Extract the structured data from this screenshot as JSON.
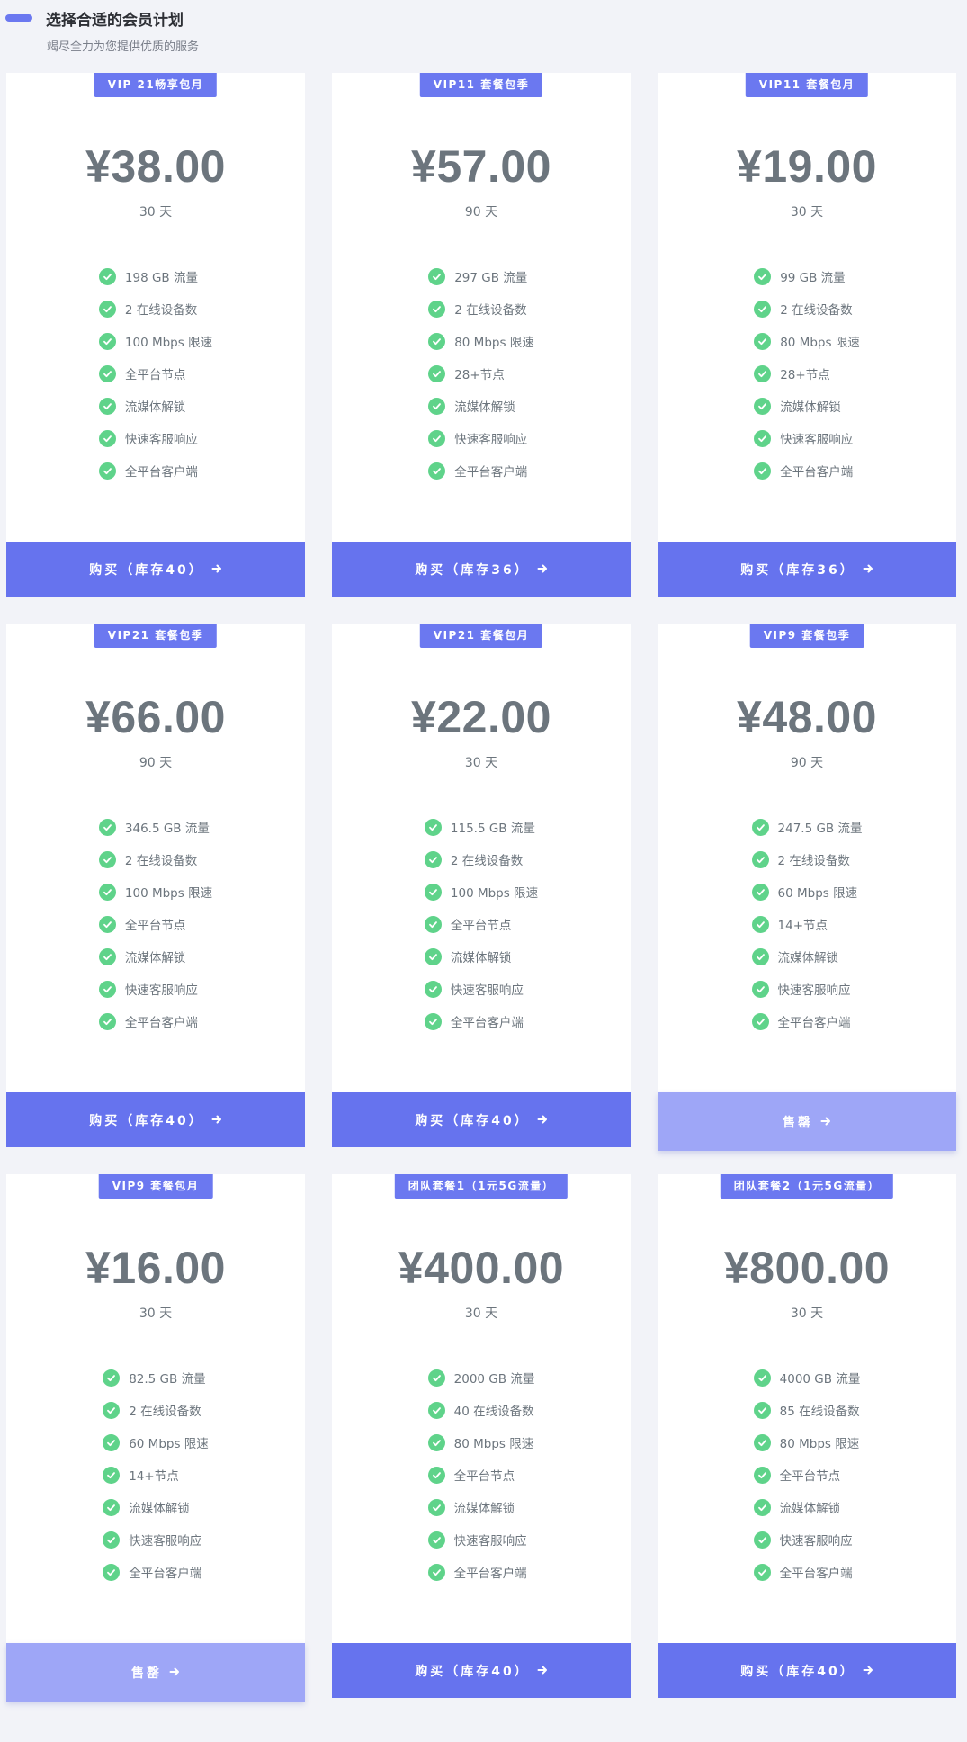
{
  "header": {
    "title": "选择合适的会员计划",
    "subtitle": "竭尽全力为您提供优质的服务"
  },
  "colors": {
    "accent": "#6b78f0",
    "button": "#6673ee",
    "button_soldout": "#9ea6f7",
    "check": "#5fd38a",
    "background": "#f2f3f8"
  },
  "plans": [
    {
      "badge": "VIP 21畅享包月",
      "price": "¥38.00",
      "duration": "30 天",
      "features": [
        "198 GB 流量",
        "2 在线设备数",
        "100 Mbps 限速",
        "全平台节点",
        "流媒体解锁",
        "快速客服响应",
        "全平台客户端"
      ],
      "button": "购买（库存40）",
      "soldout": false
    },
    {
      "badge": "VIP11 套餐包季",
      "price": "¥57.00",
      "duration": "90 天",
      "features": [
        "297 GB 流量",
        "2 在线设备数",
        "80 Mbps 限速",
        "28+节点",
        "流媒体解锁",
        "快速客服响应",
        "全平台客户端"
      ],
      "button": "购买（库存36）",
      "soldout": false
    },
    {
      "badge": "VIP11 套餐包月",
      "price": "¥19.00",
      "duration": "30 天",
      "features": [
        "99 GB 流量",
        "2 在线设备数",
        "80 Mbps 限速",
        "28+节点",
        "流媒体解锁",
        "快速客服响应",
        "全平台客户端"
      ],
      "button": "购买（库存36）",
      "soldout": false
    },
    {
      "badge": "VIP21 套餐包季",
      "price": "¥66.00",
      "duration": "90 天",
      "features": [
        "346.5 GB 流量",
        "2 在线设备数",
        "100 Mbps 限速",
        "全平台节点",
        "流媒体解锁",
        "快速客服响应",
        "全平台客户端"
      ],
      "button": "购买（库存40）",
      "soldout": false
    },
    {
      "badge": "VIP21 套餐包月",
      "price": "¥22.00",
      "duration": "30 天",
      "features": [
        "115.5 GB 流量",
        "2 在线设备数",
        "100 Mbps 限速",
        "全平台节点",
        "流媒体解锁",
        "快速客服响应",
        "全平台客户端"
      ],
      "button": "购买（库存40）",
      "soldout": false
    },
    {
      "badge": "VIP9 套餐包季",
      "price": "¥48.00",
      "duration": "90 天",
      "features": [
        "247.5 GB 流量",
        "2 在线设备数",
        "60 Mbps 限速",
        "14+节点",
        "流媒体解锁",
        "快速客服响应",
        "全平台客户端"
      ],
      "button": "售罄",
      "soldout": true
    },
    {
      "badge": "VIP9 套餐包月",
      "price": "¥16.00",
      "duration": "30 天",
      "features": [
        "82.5 GB 流量",
        "2 在线设备数",
        "60 Mbps 限速",
        "14+节点",
        "流媒体解锁",
        "快速客服响应",
        "全平台客户端"
      ],
      "button": "售罄",
      "soldout": true
    },
    {
      "badge": "团队套餐1（1元5G流量）",
      "price": "¥400.00",
      "duration": "30 天",
      "features": [
        "2000 GB 流量",
        "40 在线设备数",
        "80 Mbps 限速",
        "全平台节点",
        "流媒体解锁",
        "快速客服响应",
        "全平台客户端"
      ],
      "button": "购买（库存40）",
      "soldout": false
    },
    {
      "badge": "团队套餐2（1元5G流量）",
      "price": "¥800.00",
      "duration": "30 天",
      "features": [
        "4000 GB 流量",
        "85 在线设备数",
        "80 Mbps 限速",
        "全平台节点",
        "流媒体解锁",
        "快速客服响应",
        "全平台客户端"
      ],
      "button": "购买（库存40）",
      "soldout": false
    }
  ]
}
